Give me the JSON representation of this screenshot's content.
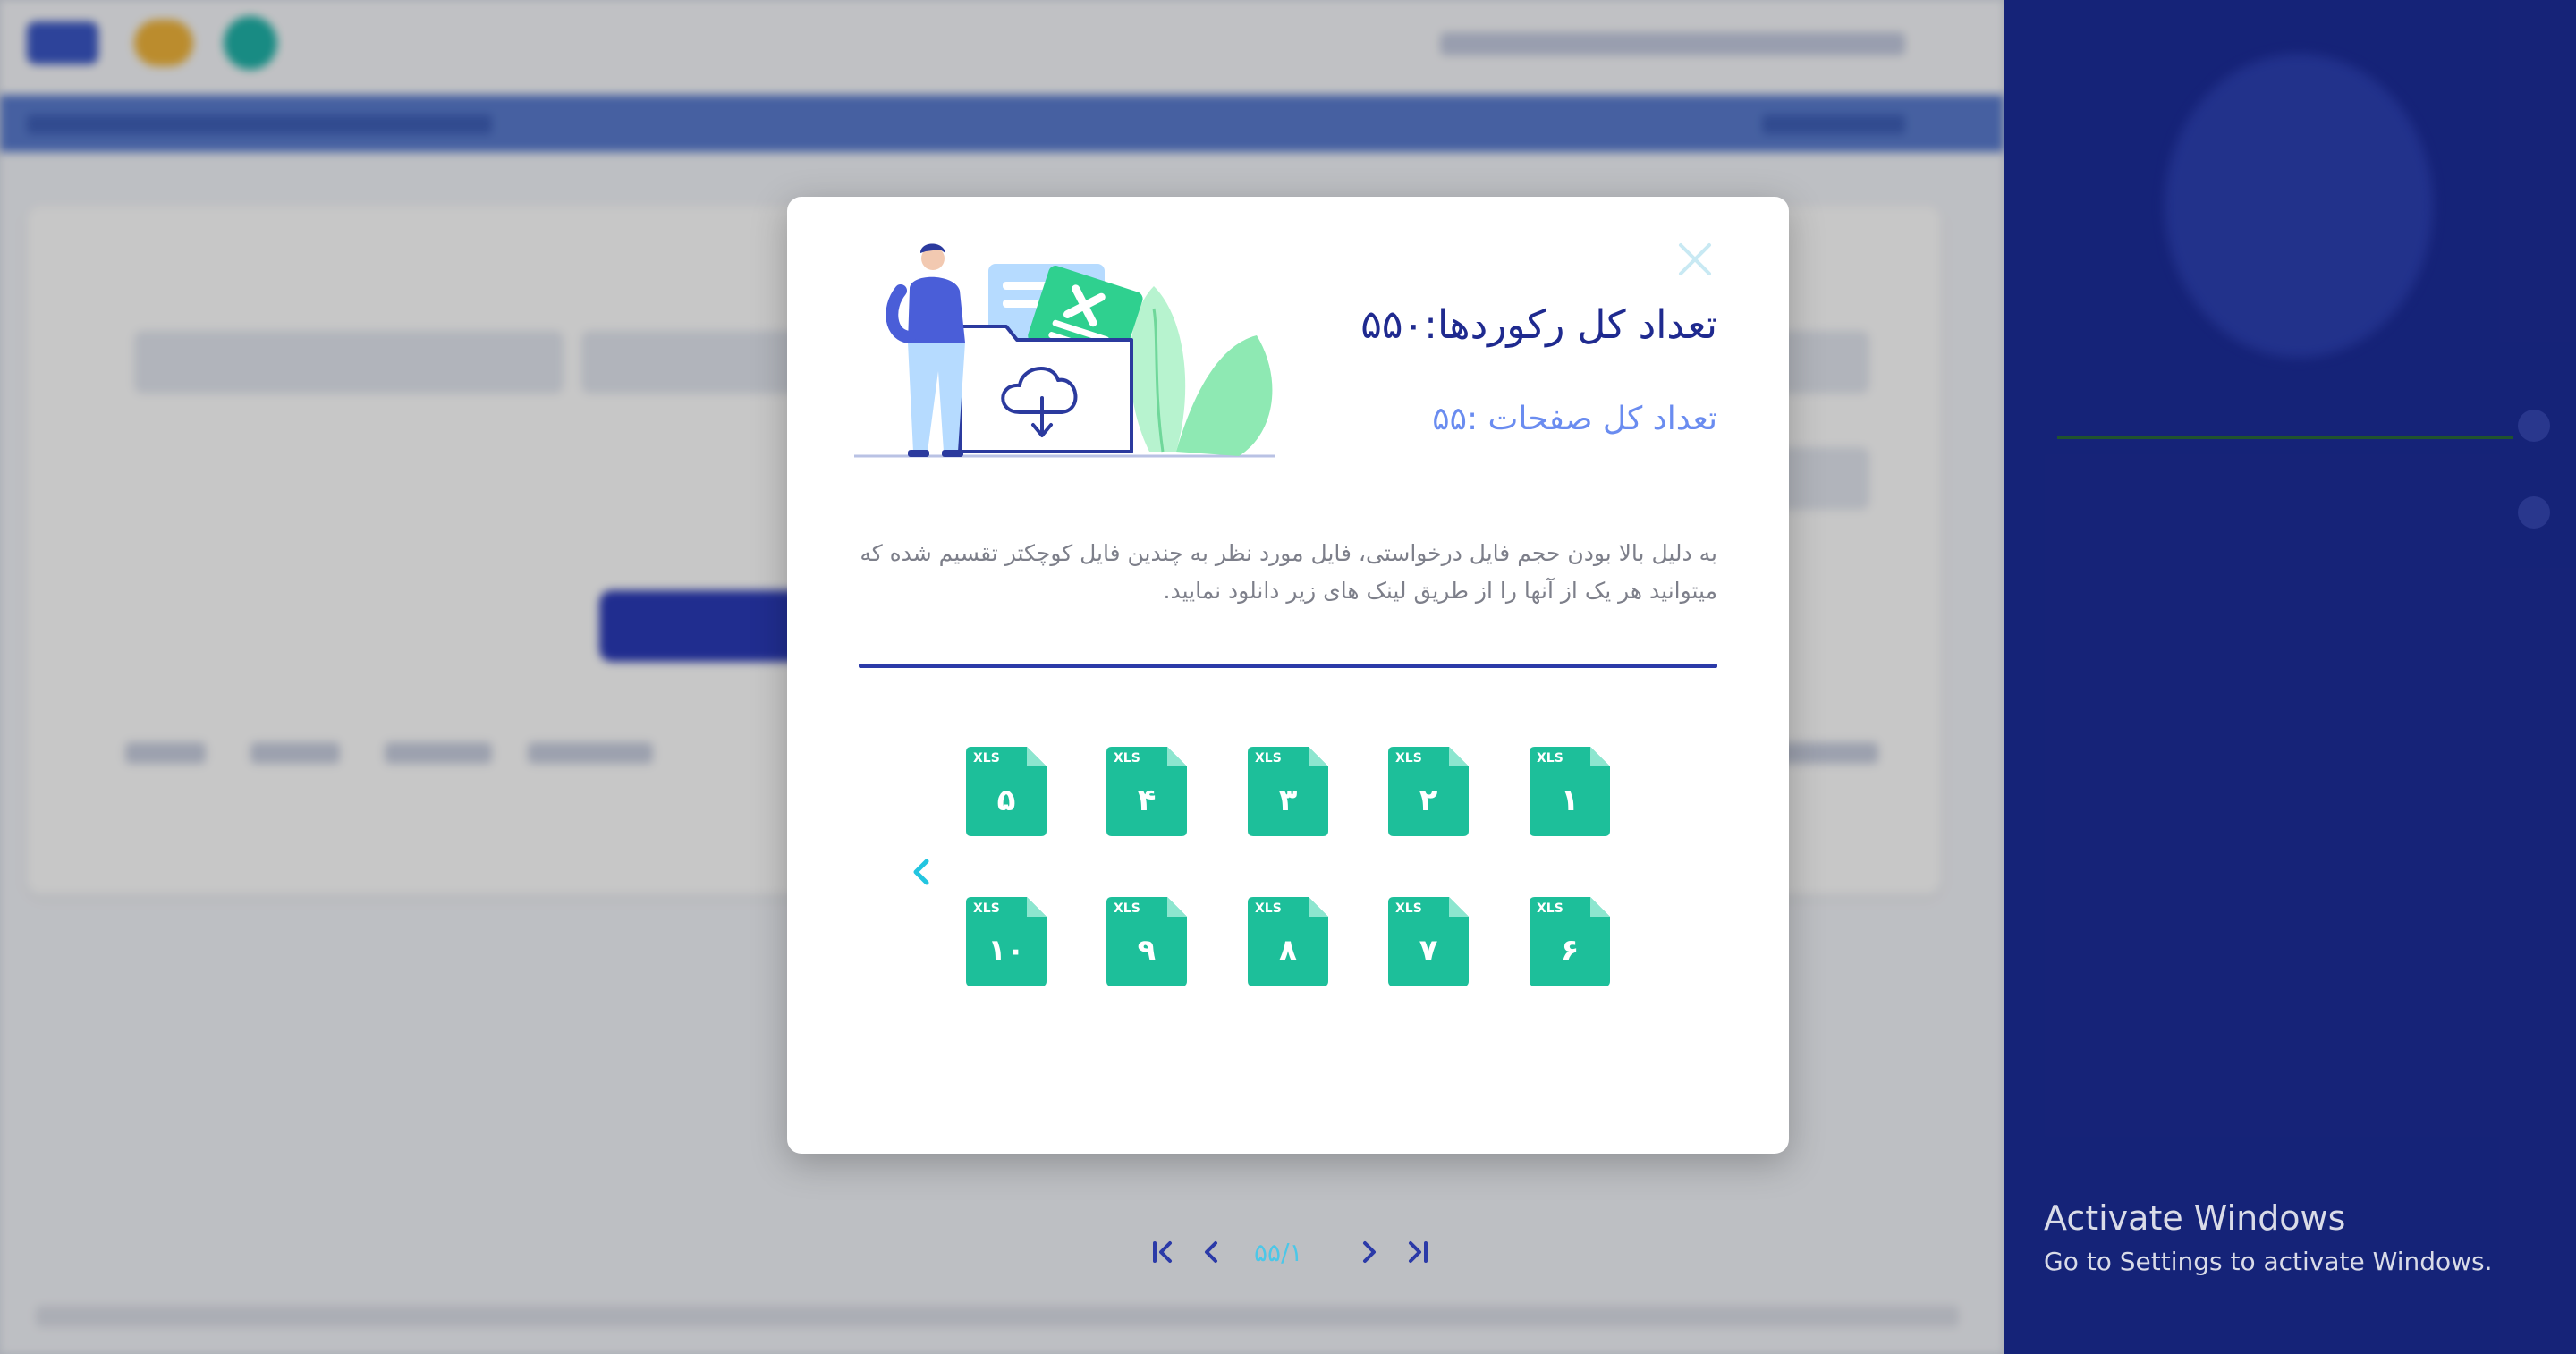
{
  "modal": {
    "total_records": "تعداد کل رکوردها:۵۵۰",
    "total_pages": "تعداد کل صفحات :۵۵",
    "description": "به دلیل بالا بودن حجم فایل درخواستی، فایل مورد نظر به چندین فایل کوچکتر تقسیم شده که میتوانید هر یک از آنها را از طریق لینک های زیر دانلود نمایید.",
    "files": [
      {
        "type": "XLS",
        "label": "۱"
      },
      {
        "type": "XLS",
        "label": "۲"
      },
      {
        "type": "XLS",
        "label": "۳"
      },
      {
        "type": "XLS",
        "label": "۴"
      },
      {
        "type": "XLS",
        "label": "۵"
      },
      {
        "type": "XLS",
        "label": "۶"
      },
      {
        "type": "XLS",
        "label": "۷"
      },
      {
        "type": "XLS",
        "label": "۸"
      },
      {
        "type": "XLS",
        "label": "۹"
      },
      {
        "type": "XLS",
        "label": "۱۰"
      }
    ],
    "pagination": {
      "current": "۱",
      "separator": "/",
      "total": "۵۵"
    }
  },
  "watermark": {
    "title": "Activate Windows",
    "subtitle": "Go to Settings to activate Windows."
  },
  "colors": {
    "file_green": "#1dbf9a",
    "title_blue": "#1f2a8f",
    "subtitle_blue": "#6a8cf0",
    "divider": "#2b3aa8",
    "accent_cyan": "#22c5e0",
    "sidebar": "#1c2d9a"
  },
  "icons": [
    "close-icon",
    "xls-file-icon",
    "chevron-left-icon",
    "chevron-right-icon",
    "first-page-icon",
    "last-page-icon",
    "cloud-download-icon"
  ]
}
